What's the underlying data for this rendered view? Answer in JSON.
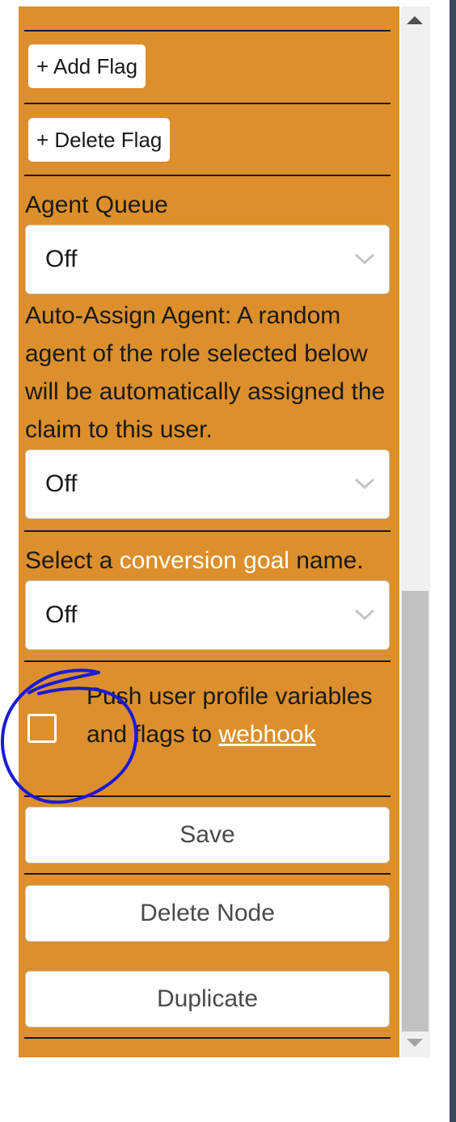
{
  "flags": {
    "add_label": "+ Add Flag",
    "delete_label": "+ Delete Flag"
  },
  "agent_queue": {
    "label": "Agent Queue",
    "value": "Off"
  },
  "auto_assign": {
    "description": "Auto-Assign Agent: A random agent of the role selected below will be automatically assigned the claim to this user.",
    "value": "Off"
  },
  "conversion": {
    "prefix": "Select a ",
    "highlight": "conversion goal",
    "suffix": " name.",
    "value": "Off"
  },
  "webhook": {
    "text": "Push user profile variables and flags to ",
    "link": "webhook",
    "checked": false
  },
  "actions": {
    "save": "Save",
    "delete_node": "Delete Node",
    "duplicate": "Duplicate"
  },
  "colors": {
    "panel": "#dc8f2c",
    "highlight": "#ffffff",
    "annotation": "#1a1ad6"
  }
}
